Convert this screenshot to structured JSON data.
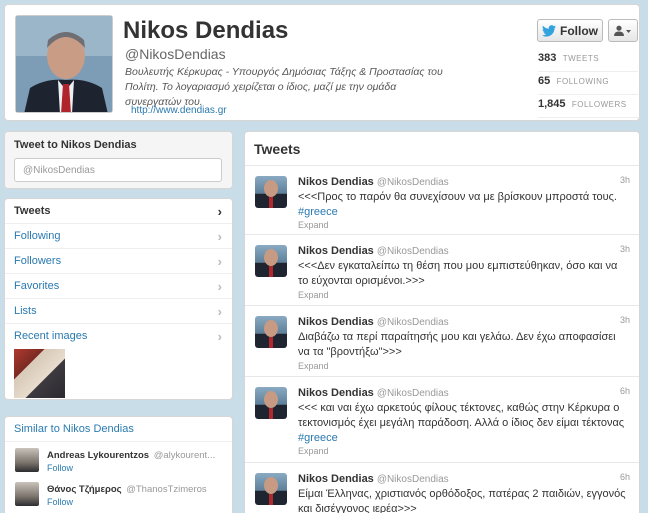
{
  "profile": {
    "name": "Nikos Dendias",
    "handle": "@NikosDendias",
    "bio": "Βουλευτής Κέρκυρας - Υπουργός Δημόσιας Τάξης & Προστασίας του Πολίτη. Το λογαριασμό χειρίζεται ο ίδιος, μαζί με την ομάδα συνεργατών του.",
    "url": "http://www.dendias.gr",
    "follow_label": "Follow",
    "stats": [
      {
        "num": "383",
        "label": "TWEETS"
      },
      {
        "num": "65",
        "label": "FOLLOWING"
      },
      {
        "num": "1,845",
        "label": "FOLLOWERS"
      }
    ]
  },
  "tweet_to": {
    "title": "Tweet to Nikos Dendias",
    "input_value": "@NikosDendias"
  },
  "nav": {
    "items": [
      {
        "label": "Tweets"
      },
      {
        "label": "Following"
      },
      {
        "label": "Followers"
      },
      {
        "label": "Favorites"
      },
      {
        "label": "Lists"
      },
      {
        "label": "Recent images"
      }
    ]
  },
  "similar": {
    "title": "Similar to Nikos Dendias",
    "items": [
      {
        "name": "Andreas Lykourentzos",
        "handle": "@alykourent...",
        "follow": "Follow"
      },
      {
        "name": "Θάνος Τζήμερος",
        "handle": "@ThanosTzimeros",
        "follow": "Follow"
      }
    ]
  },
  "tweets": {
    "header": "Tweets",
    "items": [
      {
        "name": "Nikos Dendias",
        "handle": "@NikosDendias",
        "time": "3h",
        "text": "<<<Προς το παρόν θα συνεχίσουν να με βρίσκουν μπροστά τους.",
        "tag": "#greece",
        "expand": "Expand"
      },
      {
        "name": "Nikos Dendias",
        "handle": "@NikosDendias",
        "time": "3h",
        "text": "<<<Δεν εγκαταλείπω τη θέση που μου εμπιστεύθηκαν, όσο και να το εύχονται ορισμένοι.>>>",
        "tag": "",
        "expand": "Expand"
      },
      {
        "name": "Nikos Dendias",
        "handle": "@NikosDendias",
        "time": "3h",
        "text": "Διαβάζω τα περί παραίτησής μου και γελάω. Δεν έχω αποφασίσει να τα \"βροντήξω\">>>",
        "tag": "",
        "expand": "Expand"
      },
      {
        "name": "Nikos Dendias",
        "handle": "@NikosDendias",
        "time": "6h",
        "text": "<<< και ναι έχω αρκετούς φίλους τέκτονες, καθώς στην Κέρκυρα ο τεκτονισμός έχει μεγάλη παράδοση. Αλλά ο ίδιος δεν είμαι τέκτονας",
        "tag": "#greece",
        "expand": "Expand"
      },
      {
        "name": "Nikos Dendias",
        "handle": "@NikosDendias",
        "time": "6h",
        "text": "Είμαι Έλληνας, χριστιανός ορθόδοξος, πατέρας 2 παιδιών, εγγονός και δισέγγονος ιερέα>>>",
        "tag": "",
        "expand": ""
      }
    ]
  }
}
